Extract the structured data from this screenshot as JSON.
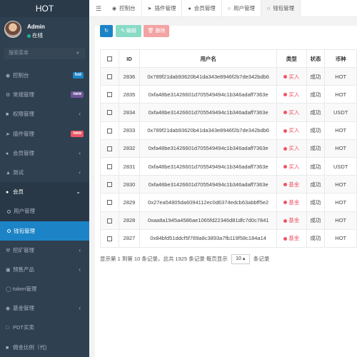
{
  "app": {
    "title": "HOT"
  },
  "user": {
    "name": "Admin",
    "status": "在线"
  },
  "search": {
    "placeholder": "搜索菜单"
  },
  "sidebar": {
    "items": [
      {
        "label": "控制台",
        "icon": "dashboard-icon",
        "badge": "hot",
        "badge_color": "#1c84c6"
      },
      {
        "label": "常规管理",
        "icon": "cogs-icon",
        "badge": "new",
        "badge_color": "#6f5499"
      },
      {
        "label": "权限管理",
        "icon": "group-icon"
      },
      {
        "label": "插件管理",
        "icon": "rocket-icon",
        "badge": "new",
        "badge_color": "#ed5565"
      },
      {
        "label": "会员管理",
        "icon": "user-icon"
      },
      {
        "label": "测试",
        "icon": "flask-icon"
      },
      {
        "label": "会员",
        "icon": "user-icon",
        "open": true
      },
      {
        "label": "用户管理",
        "icon": "circle-icon",
        "sub": true
      },
      {
        "label": "钱包管理",
        "icon": "circle-icon",
        "sub": true,
        "active": true
      },
      {
        "label": "挖矿管理",
        "icon": "pickaxe-icon"
      },
      {
        "label": "预售产品",
        "icon": "shopping-icon"
      },
      {
        "label": "token管理",
        "icon": "token-icon"
      },
      {
        "label": "基金管理",
        "icon": "fund-icon"
      },
      {
        "label": "PDT买卖",
        "icon": "trade-icon"
      },
      {
        "label": "佣金比例（代)",
        "icon": "percent-icon"
      }
    ]
  },
  "tabs": [
    {
      "label": "控制台",
      "icon": "dashboard-icon"
    },
    {
      "label": "插件管理",
      "icon": "rocket-icon"
    },
    {
      "label": "会员管理",
      "icon": "user-icon"
    },
    {
      "label": "用户管理",
      "icon": "circle-icon"
    },
    {
      "label": "钱包管理",
      "icon": "circle-icon",
      "active": true
    }
  ],
  "toolbar": {
    "edit_label": "编辑",
    "delete_label": "删除"
  },
  "table": {
    "headers": [
      "ID",
      "用户名",
      "类型",
      "状态",
      "币种"
    ],
    "rows": [
      {
        "id": "2836",
        "username": "0x789f21dab93620b41da343e8946f2b7de342bdb6",
        "type": "买入",
        "status": "成功",
        "coin": "HOT"
      },
      {
        "id": "2835",
        "username": "0xfa48be31426601d705549494c1b346adaff7363e",
        "type": "买入",
        "status": "成功",
        "coin": "HOT"
      },
      {
        "id": "2834",
        "username": "0xfa48be31426601d705549494c1b346adaff7363e",
        "type": "买入",
        "status": "成功",
        "coin": "USDT"
      },
      {
        "id": "2833",
        "username": "0x789f21dab93620b41da343e8946f2b7de342bdb6",
        "type": "买入",
        "status": "成功",
        "coin": "HOT"
      },
      {
        "id": "2832",
        "username": "0xfa48be31426601d705549494c1b346adaff7363e",
        "type": "买入",
        "status": "成功",
        "coin": "HOT"
      },
      {
        "id": "2831",
        "username": "0xfa48be31426601d705549494c1b346adaff7363e",
        "type": "买入",
        "status": "成功",
        "coin": "USDT"
      },
      {
        "id": "2830",
        "username": "0xfa48be31426601d705549494c1b346adaff7363e",
        "type": "基金",
        "status": "成功",
        "coin": "HOT"
      },
      {
        "id": "2829",
        "username": "0x27ea54805da6094112ec0d6374edcb63abbff5e2",
        "type": "基金",
        "status": "成功",
        "coin": "HOT"
      },
      {
        "id": "2828",
        "username": "0xaa8a1945a4586ae1065fd22346d81dfc7d0c7841",
        "type": "基金",
        "status": "成功",
        "coin": "HOT"
      },
      {
        "id": "2827",
        "username": "0x84bfd51ddcf5f789a8c3893a7fb119f58c184a14",
        "type": "基金",
        "status": "成功",
        "coin": "HOT"
      }
    ]
  },
  "pagination": {
    "summary": "显示第 1 到第 10 条记录，总共 1925 条记录 每页显示",
    "page_size": "10",
    "suffix": "条记录"
  }
}
